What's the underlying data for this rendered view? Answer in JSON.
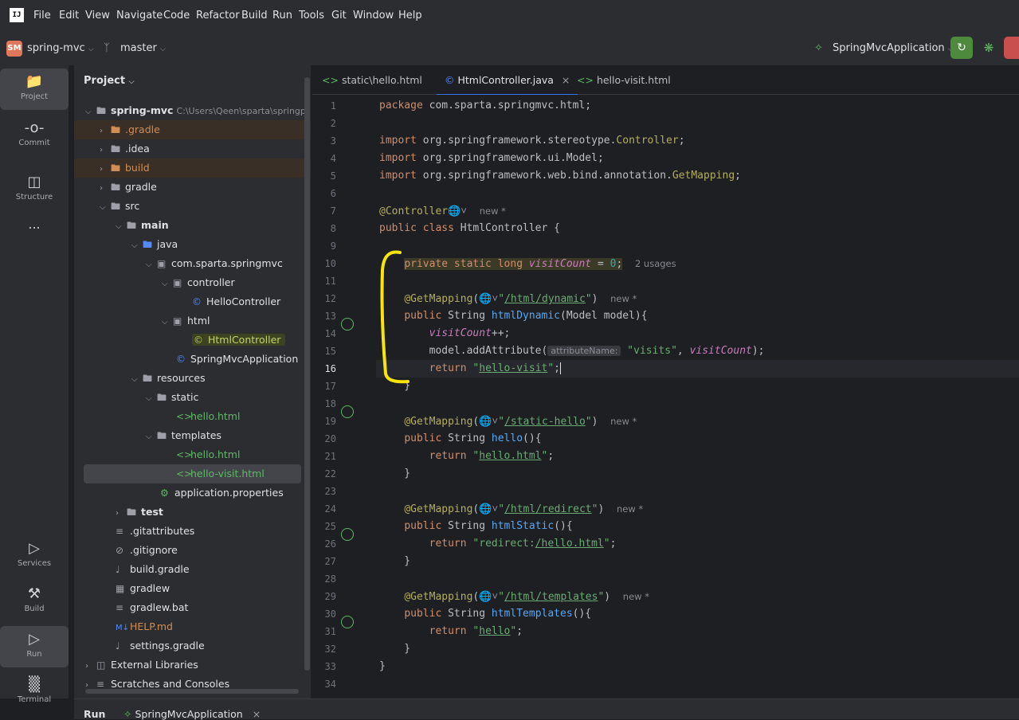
{
  "menu": [
    "File",
    "Edit",
    "View",
    "Navigate",
    "Code",
    "Refactor",
    "Build",
    "Run",
    "Tools",
    "Git",
    "Window",
    "Help"
  ],
  "logo": "IJ",
  "toolbar": {
    "project_badge": "SM",
    "project_name": "spring-mvc",
    "branch": "master",
    "run_config": "SpringMvcApplication"
  },
  "tools": {
    "project": "Project",
    "commit": "Commit",
    "structure": "Structure",
    "more": "...",
    "services": "Services",
    "build": "Build",
    "run": "Run",
    "terminal": "Terminal"
  },
  "project_panel": {
    "title": "Project",
    "tree": [
      {
        "label": "spring-mvc",
        "extra": "C:\\Users\\Qeen\\sparta\\springp",
        "bold": true
      },
      {
        "label": ".gradle"
      },
      {
        "label": ".idea"
      },
      {
        "label": "build"
      },
      {
        "label": "gradle"
      },
      {
        "label": "src"
      },
      {
        "label": "main",
        "bold": true
      },
      {
        "label": "java"
      },
      {
        "label": "com.sparta.springmvc"
      },
      {
        "label": "controller"
      },
      {
        "label": "HelloController"
      },
      {
        "label": "html"
      },
      {
        "label": "HtmlController"
      },
      {
        "label": "SpringMvcApplication"
      },
      {
        "label": "resources"
      },
      {
        "label": "static"
      },
      {
        "label": "hello.html"
      },
      {
        "label": "templates"
      },
      {
        "label": "hello.html"
      },
      {
        "label": "hello-visit.html"
      },
      {
        "label": "application.properties"
      },
      {
        "label": "test",
        "bold": true
      },
      {
        "label": ".gitattributes"
      },
      {
        "label": ".gitignore"
      },
      {
        "label": "build.gradle"
      },
      {
        "label": "gradlew"
      },
      {
        "label": "gradlew.bat"
      },
      {
        "label": "HELP.md"
      },
      {
        "label": "settings.gradle"
      },
      {
        "label": "External Libraries"
      },
      {
        "label": "Scratches and Consoles"
      }
    ]
  },
  "tabs": [
    {
      "label": "static\\hello.html"
    },
    {
      "label": "HtmlController.java",
      "close": "×"
    },
    {
      "label": "hello-visit.html"
    }
  ],
  "editor": {
    "line_numbers": [
      "1",
      "2",
      "3",
      "4",
      "5",
      "6",
      "7",
      "8",
      "9",
      "10",
      "11",
      "12",
      "13",
      "14",
      "15",
      "16",
      "17",
      "18",
      "19",
      "20",
      "21",
      "22",
      "23",
      "24",
      "25",
      "26",
      "27",
      "28",
      "29",
      "30",
      "31",
      "32",
      "33",
      "34"
    ],
    "hints": {
      "new": "new *",
      "usages": "2 usages",
      "param": "attributeName:"
    }
  },
  "bottom": {
    "run_label": "Run",
    "run_tab": "SpringMvcApplication",
    "close": "×"
  }
}
